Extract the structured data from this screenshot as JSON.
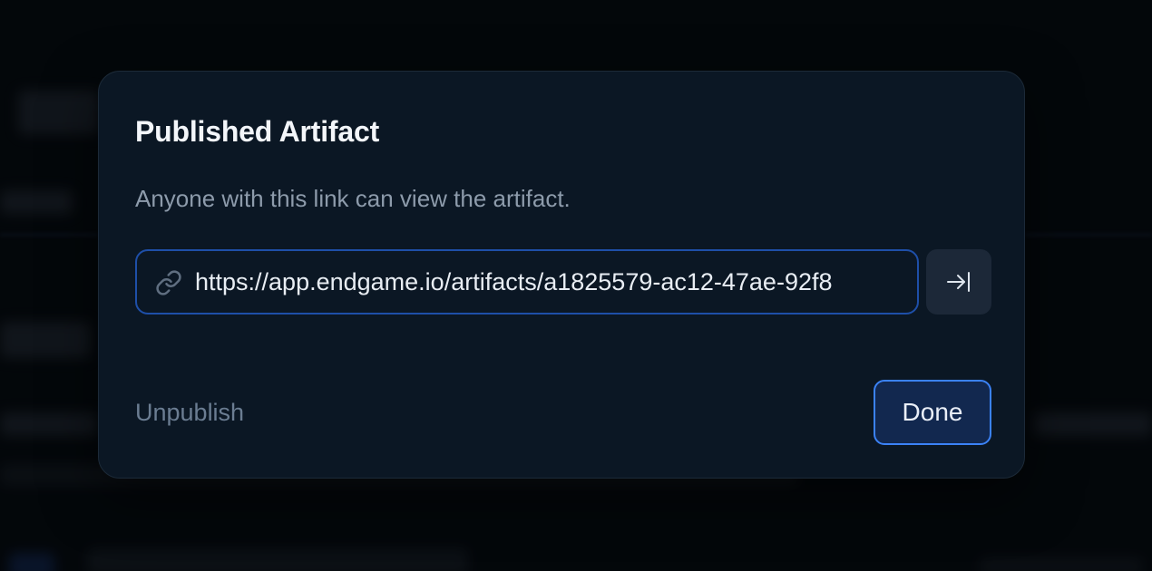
{
  "dialog": {
    "title": "Published Artifact",
    "description": "Anyone with this link can view the artifact.",
    "link_url": "https://app.endgame.io/artifacts/a1825579-ac12-47ae-92f8",
    "unpublish_label": "Unpublish",
    "done_label": "Done"
  },
  "icons": {
    "link": "link-icon",
    "open": "arrow-right-to-bar-icon"
  },
  "colors": {
    "modal_background": "#0b1724",
    "field_border": "#1e4fa8",
    "done_border": "#3b82f6",
    "done_background": "#12284f"
  }
}
